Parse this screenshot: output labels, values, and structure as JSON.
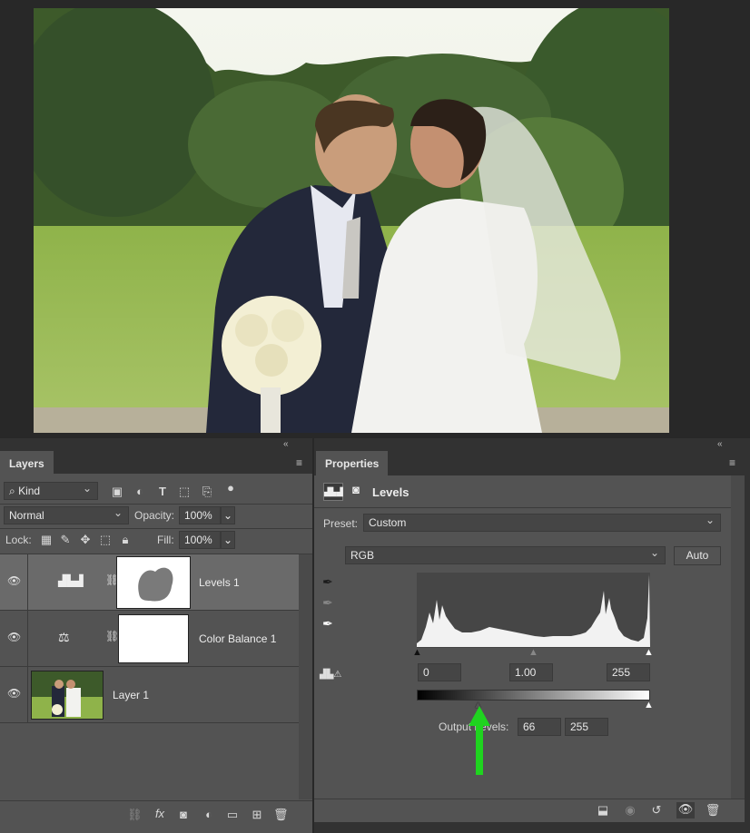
{
  "layers_panel": {
    "tab_label": "Layers",
    "filter_kind": "Kind",
    "blend_mode": "Normal",
    "opacity_label": "Opacity:",
    "opacity_value": "100%",
    "lock_label": "Lock:",
    "fill_label": "Fill:",
    "fill_value": "100%",
    "layers": [
      {
        "name": "Levels 1"
      },
      {
        "name": "Color Balance 1"
      },
      {
        "name": "Layer 1"
      }
    ],
    "footer_fx": "fx"
  },
  "properties_panel": {
    "tab_label": "Properties",
    "adjustment_title": "Levels",
    "preset_label": "Preset:",
    "preset_value": "Custom",
    "channel_value": "RGB",
    "auto_label": "Auto",
    "input_black": "0",
    "input_gamma": "1.00",
    "input_white": "255",
    "output_label": "Output Levels:",
    "output_black": "66",
    "output_white": "255"
  },
  "annotation": {
    "arrow_color": "#1fd41f"
  }
}
